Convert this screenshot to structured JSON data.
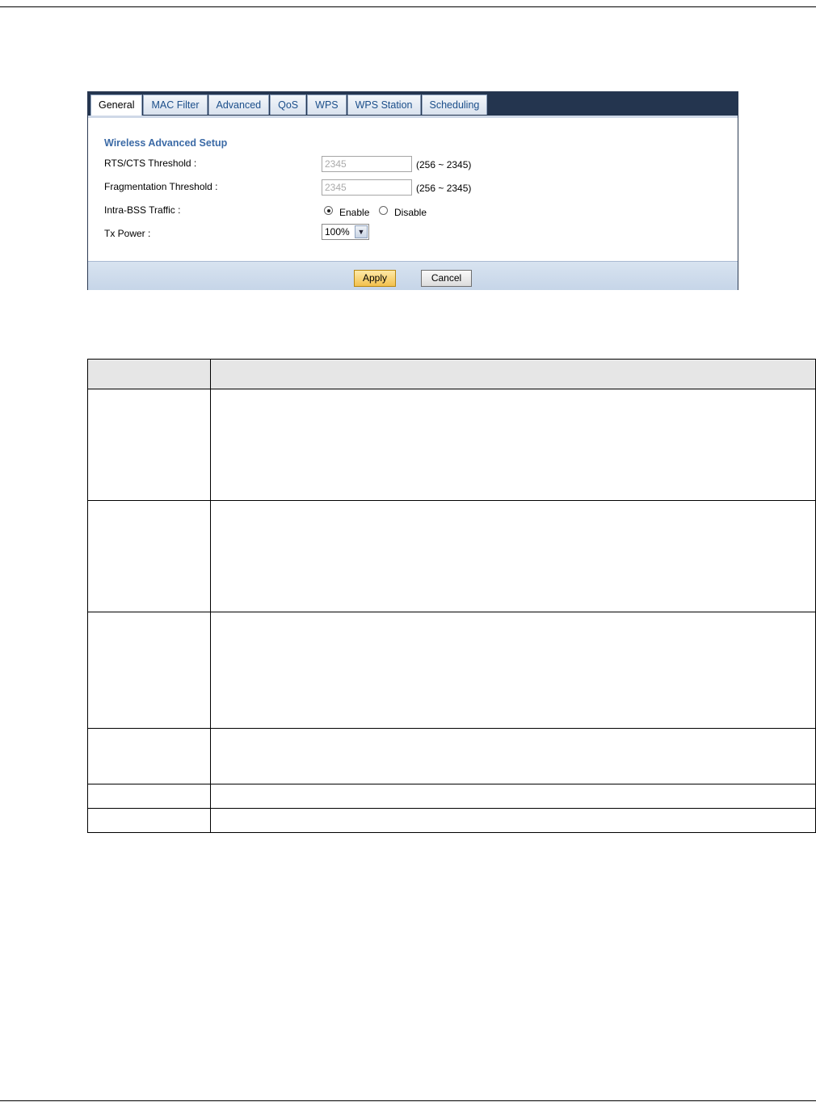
{
  "tabs": [
    "General",
    "MAC Filter",
    "Advanced",
    "QoS",
    "WPS",
    "WPS Station",
    "Scheduling"
  ],
  "active_tab": "General",
  "section_title": "Wireless Advanced Setup",
  "fields": {
    "rts_label": "RTS/CTS Threshold :",
    "rts_value": "2345",
    "rts_range": "(256 ~ 2345)",
    "frag_label": "Fragmentation Threshold :",
    "frag_value": "2345",
    "frag_range": "(256 ~ 2345)",
    "intra_label": "Intra-BSS Traffic :",
    "enable_label": "Enable",
    "disable_label": "Disable",
    "intra_selected": "Enable",
    "tx_label": "Tx Power :",
    "tx_value": "100%"
  },
  "buttons": {
    "apply": "Apply",
    "cancel": "Cancel"
  },
  "doc_table": {
    "header": [
      "",
      ""
    ],
    "rows": [
      [
        "",
        ""
      ],
      [
        "",
        ""
      ],
      [
        "",
        ""
      ],
      [
        "",
        ""
      ],
      [
        "",
        ""
      ],
      [
        "",
        ""
      ]
    ]
  }
}
